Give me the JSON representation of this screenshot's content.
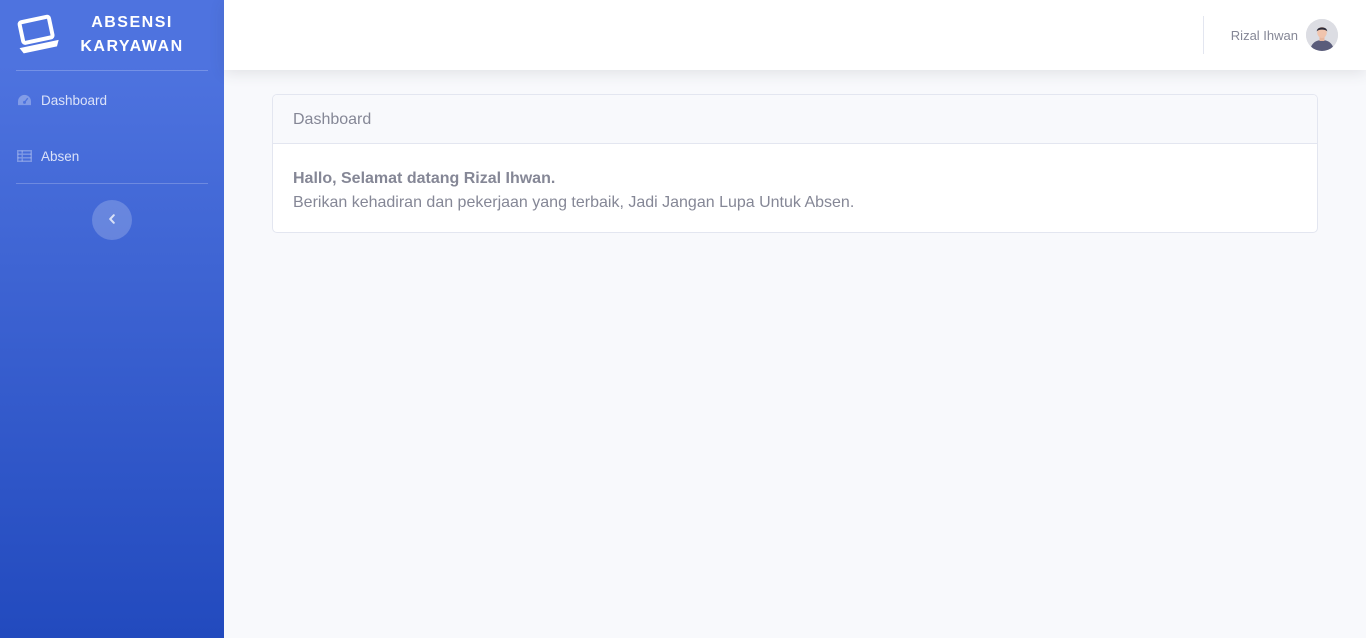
{
  "sidebar": {
    "brand": {
      "line1": "ABSENSI",
      "line2": "KARYAWAN",
      "icon": "laptop-icon"
    },
    "items": [
      {
        "label": "Dashboard",
        "icon": "tachometer-icon"
      },
      {
        "label": "Absen",
        "icon": "table-icon"
      }
    ],
    "toggle_icon": "chevron-left-icon"
  },
  "topbar": {
    "user_name": "Rizal Ihwan",
    "avatar_icon": "user-avatar"
  },
  "main": {
    "card_title": "Dashboard",
    "greeting": "Hallo, Selamat datang Rizal Ihwan.",
    "message": "Berikan kehadiran dan pekerjaan yang terbaik, Jadi Jangan Lupa Untuk Absen."
  },
  "colors": {
    "sidebar_top": "#4e73df",
    "sidebar_bottom": "#224abe",
    "page_bg": "#f8f9fc",
    "text_gray": "#858796"
  }
}
